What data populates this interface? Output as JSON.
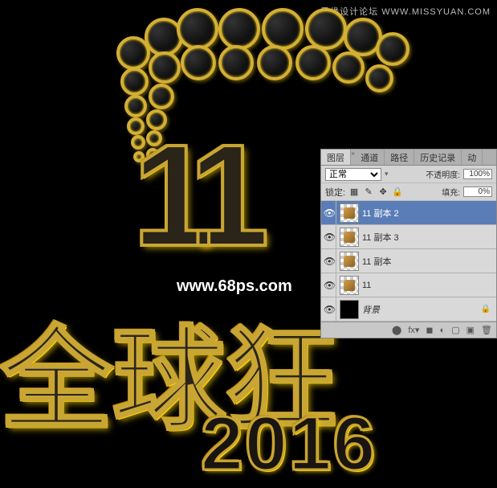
{
  "watermarks": {
    "top": "思缘设计论坛 WWW.MISSYUAN.COM",
    "center": "www.68ps.com"
  },
  "artwork": {
    "text_11": "11",
    "text_chinese": "全球狂",
    "text_year": "2016"
  },
  "panel": {
    "tabs": [
      "图层",
      "通道",
      "路径",
      "历史记录",
      "动"
    ],
    "active_tab": 0,
    "blend_mode": "正常",
    "opacity_label": "不透明度:",
    "opacity_value": "100%",
    "lock_label": "锁定:",
    "fill_label": "填充:",
    "fill_value": "0%",
    "layers": [
      {
        "name": "11 副本 2",
        "visible": true,
        "selected": true,
        "thumb": "checker",
        "locked": false
      },
      {
        "name": "11 副本 3",
        "visible": true,
        "selected": false,
        "thumb": "checker",
        "locked": false
      },
      {
        "name": "11 副本",
        "visible": true,
        "selected": false,
        "thumb": "checker",
        "locked": false
      },
      {
        "name": "11",
        "visible": true,
        "selected": false,
        "thumb": "checker",
        "locked": false
      },
      {
        "name": "背景",
        "visible": true,
        "selected": false,
        "thumb": "black",
        "locked": true
      }
    ],
    "footer_icons": [
      "link",
      "fx",
      "mask",
      "adjust",
      "folder",
      "new",
      "trash"
    ]
  }
}
